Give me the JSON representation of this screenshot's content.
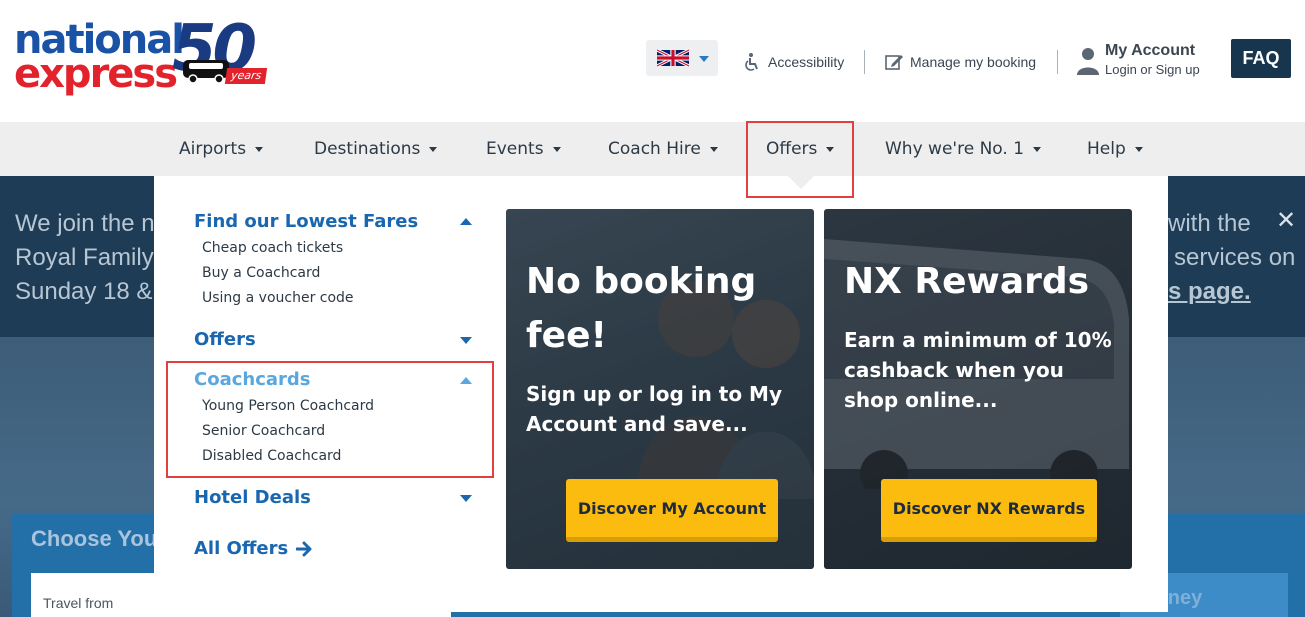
{
  "logo": {
    "line1": "national",
    "line2": "express",
    "anniversary": "50",
    "years": "years"
  },
  "header": {
    "accessibility": "Accessibility",
    "manage_booking": "Manage my booking",
    "account_title": "My Account",
    "account_sub": "Login or Sign up",
    "faq": "FAQ"
  },
  "nav": {
    "items": [
      {
        "label": "Airports"
      },
      {
        "label": "Destinations"
      },
      {
        "label": "Events"
      },
      {
        "label": "Coach Hire"
      },
      {
        "label": "Offers"
      },
      {
        "label": "Why we're No. 1"
      },
      {
        "label": "Help"
      }
    ],
    "active": "Offers"
  },
  "banner": {
    "left_lines": [
      "We join the n",
      "Royal Family",
      "Sunday 18 &"
    ],
    "right_lines": [
      "with the",
      "services on",
      "s page."
    ]
  },
  "search": {
    "choose": "Choose You",
    "travel_from": "Travel from",
    "journey": "rney"
  },
  "menu": {
    "sections": [
      {
        "title": "Find our Lowest Fares",
        "expanded": true,
        "links": [
          "Cheap coach tickets",
          "Buy a Coachcard",
          "Using a voucher code"
        ]
      },
      {
        "title": "Offers",
        "expanded": false,
        "links": []
      },
      {
        "title": "Coachcards",
        "expanded": true,
        "links": [
          "Young Person Coachcard",
          "Senior Coachcard",
          "Disabled Coachcard"
        ]
      },
      {
        "title": "Hotel Deals",
        "expanded": false,
        "links": []
      }
    ],
    "all_offers": "All Offers"
  },
  "cards": [
    {
      "title": "No booking fee!",
      "body": "Sign up or log in to My Account and save...",
      "button": "Discover My Account"
    },
    {
      "title": "NX Rewards",
      "body": "Earn a minimum of 10% cashback when you shop online...",
      "button": "Discover NX Rewards"
    }
  ],
  "colors": {
    "brand_blue": "#1a67b0",
    "brand_red": "#e3232c",
    "cta_yellow": "#fbbb0f",
    "nav_bg": "#eeeeee",
    "faq_bg": "#17364e",
    "highlight_red": "#e04040"
  }
}
